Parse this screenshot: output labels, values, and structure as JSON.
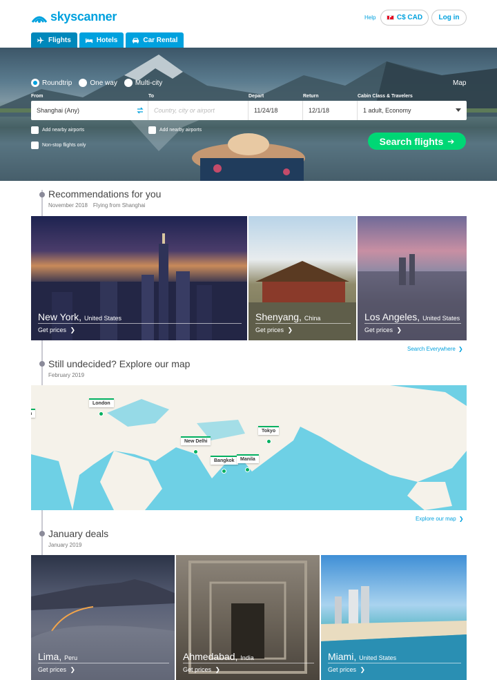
{
  "brand": {
    "name": "skyscanner",
    "color": "#00a1de"
  },
  "header": {
    "help": "Help",
    "currency": "C$ CAD",
    "login": "Log in"
  },
  "tabs": [
    {
      "label": "Flights",
      "icon": "plane-icon"
    },
    {
      "label": "Hotels",
      "icon": "bed-icon"
    },
    {
      "label": "Car Rental",
      "icon": "car-icon"
    }
  ],
  "search": {
    "trip_types": [
      "Roundtrip",
      "One way",
      "Multi-city"
    ],
    "selected_trip_type": "Roundtrip",
    "map_link": "Map",
    "labels": {
      "from": "From",
      "to": "To",
      "depart": "Depart",
      "return": "Return",
      "cabin": "Cabin Class & Travelers"
    },
    "from_value": "Shanghai (Any)",
    "to_placeholder": "Country, city or airport",
    "depart_value": "11/24/18",
    "return_value": "12/1/18",
    "cabin_value": "1 adult, Economy",
    "nearby_from": "Add nearby airports",
    "nearby_to": "Add nearby airports",
    "nonstop": "Non-stop flights only",
    "button": "Search flights"
  },
  "recommendations": {
    "title": "Recommendations for you",
    "month": "November 2018",
    "origin": "Flying from Shanghai",
    "cards": [
      {
        "city": "New York,",
        "country": "United States",
        "cta": "Get prices"
      },
      {
        "city": "Shenyang,",
        "country": "China",
        "cta": "Get prices"
      },
      {
        "city": "Los Angeles,",
        "country": "United States",
        "cta": "Get prices"
      }
    ],
    "more": "Search Everywhere"
  },
  "explore": {
    "title": "Still undecided? Explore our map",
    "month": "February 2019",
    "pins": [
      "London",
      "New Delhi",
      "Bangkok",
      "Manila",
      "Tokyo",
      "n"
    ],
    "more": "Explore our map"
  },
  "deals": {
    "title": "January deals",
    "month": "January 2019",
    "cards": [
      {
        "city": "Lima,",
        "country": "Peru",
        "cta": "Get prices"
      },
      {
        "city": "Ahmedabad,",
        "country": "India",
        "cta": "Get prices"
      },
      {
        "city": "Miami,",
        "country": "United States",
        "cta": "Get prices"
      }
    ]
  },
  "colors": {
    "accent": "#00a1de",
    "cta_green": "#00d775",
    "pin_green": "#00b060",
    "ocean": "#6ed0e5",
    "land": "#f5f2ea"
  }
}
